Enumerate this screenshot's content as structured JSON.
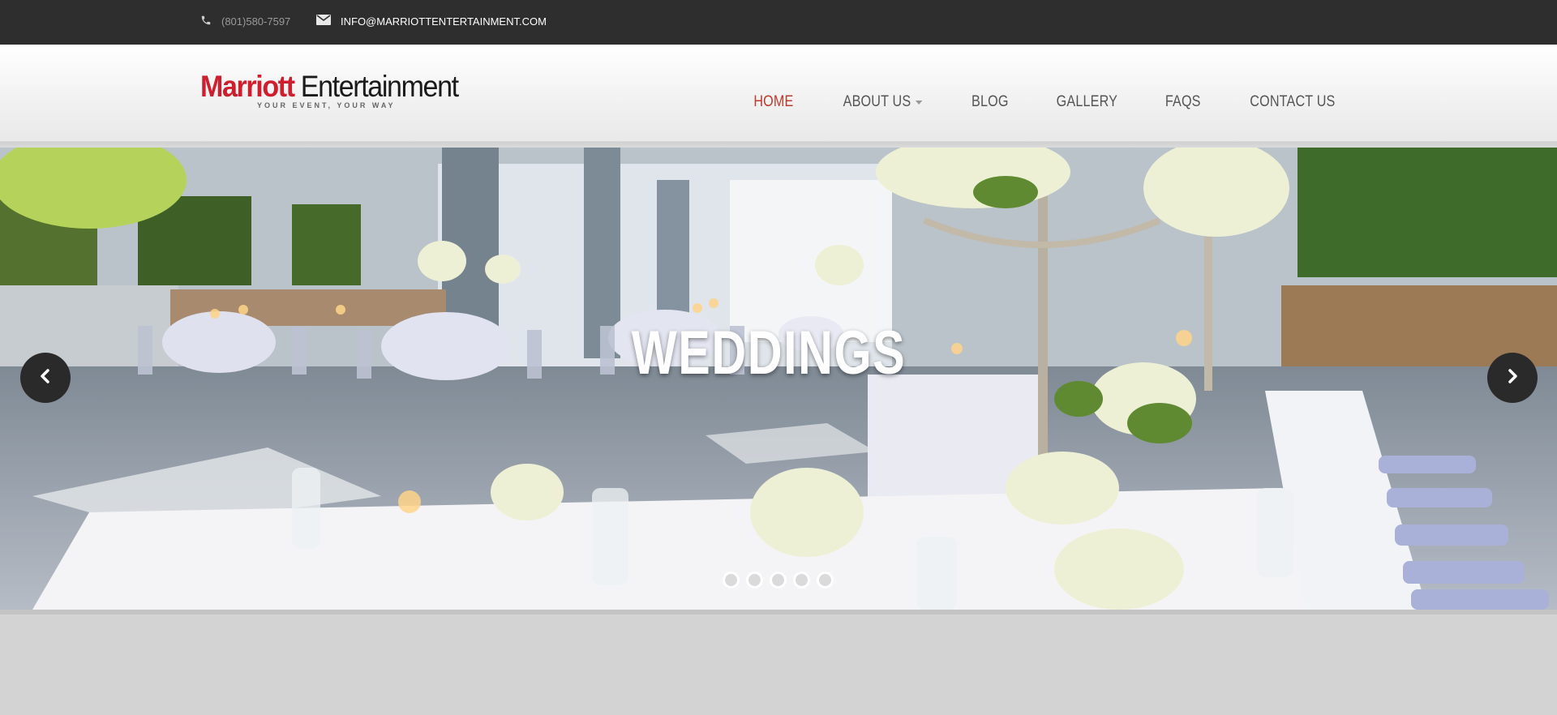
{
  "topbar": {
    "phone": "(801)580-7597",
    "email": "INFO@MARRIOTTENTERTAINMENT.COM",
    "phone_icon": "phone-icon",
    "email_icon": "envelope-icon"
  },
  "logo": {
    "word1": "Marriott",
    "word2": " Entertainment",
    "tagline": "YOUR EVENT, YOUR WAY"
  },
  "nav": {
    "items": [
      {
        "label": "HOME",
        "active": true
      },
      {
        "label": "ABOUT US",
        "has_dropdown": true
      },
      {
        "label": "BLOG"
      },
      {
        "label": "GALLERY"
      },
      {
        "label": "FAQS"
      },
      {
        "label": "CONTACT US"
      }
    ]
  },
  "slider": {
    "caption": "WEDDINGS",
    "prev_icon": "chevron-left-icon",
    "next_icon": "chevron-right-icon",
    "slide_count": 5,
    "active_slide": 1
  },
  "colors": {
    "accent": "#c0392b",
    "logo_red": "#cf1f2e",
    "topbar_bg": "#2e2e2e"
  }
}
